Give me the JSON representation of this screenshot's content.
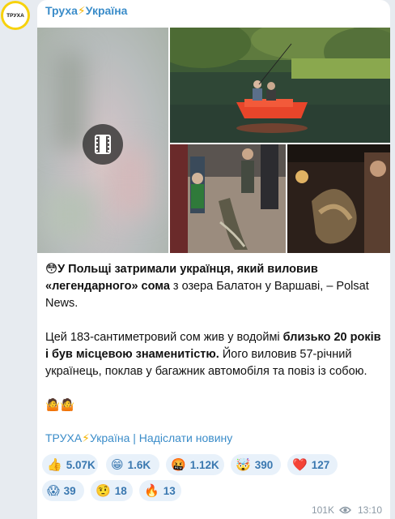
{
  "avatar": {
    "text": "ТРУХА",
    "ring_color": "#f7d20d"
  },
  "post": {
    "channel_name": "Труха",
    "channel_bolt": "⚡",
    "channel_suffix": "Україна",
    "paragraph1": {
      "emoji": "😳",
      "bold1": "У Польщі затримали українця, який виловив «легендарного» сома",
      "text1": " з озера Балатон у Варшаві, – Polsat News."
    },
    "paragraph2": {
      "text1": "Цей 183-сантиметровий сом жив у водоймі ",
      "bold1": "близько 20 років і був місцевою знаменитістю.",
      "text2": " Його виловив 57-річний українець, поклав у багажник автомобіля та повіз із собою."
    },
    "paragraph3": {
      "emojis": "🤷🤷"
    },
    "footer": {
      "channel_link_name": "ТРУХА",
      "channel_link_bolt": "⚡",
      "channel_link_suffix": "Україна",
      "separator": " | ",
      "send_news_link": "Надіслати новину"
    },
    "reactions": [
      {
        "emoji": "👍",
        "count": "5.07K"
      },
      {
        "emoji": "😁",
        "count": "1.6K"
      },
      {
        "emoji": "🤬",
        "count": "1.12K"
      },
      {
        "emoji": "🤯",
        "count": "390"
      },
      {
        "emoji": "❤️",
        "count": "127"
      },
      {
        "emoji": "😱",
        "count": "39"
      },
      {
        "emoji": "🤨",
        "count": "18"
      },
      {
        "emoji": "🔥",
        "count": "13"
      }
    ],
    "views": "101K",
    "time": "13:10"
  },
  "colors": {
    "background": "#e7ebf0",
    "bubble": "#ffffff",
    "link": "#3a8cc9",
    "reaction_bg": "#e8f1fa",
    "meta": "#8c99a5"
  },
  "icons": {
    "play": "film-strip-icon",
    "views": "eye-icon"
  }
}
